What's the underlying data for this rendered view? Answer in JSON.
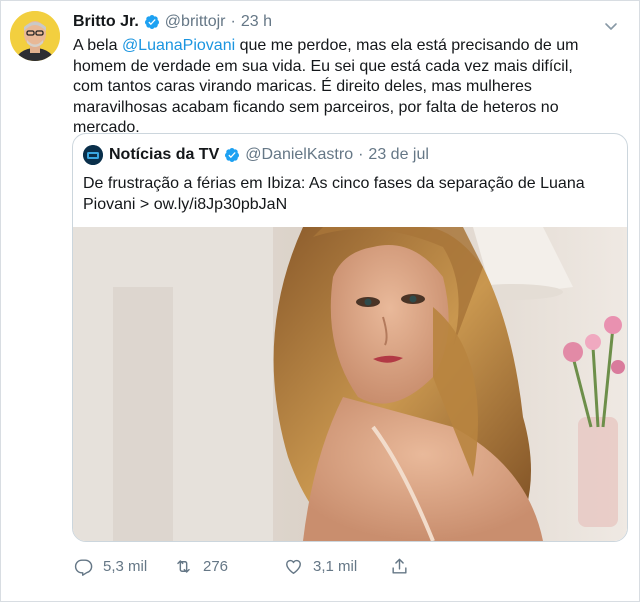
{
  "tweet": {
    "author_name": "Britto Jr.",
    "handle": "@brittojr",
    "separator": "·",
    "time": "23 h",
    "text_part1": "A bela ",
    "mention": "@LuanaPiovani",
    "text_part2": " que me perdoe, mas ela está precisando de um homem de verdade em sua vida. Eu sei que está cada vez mais difícil, com tantos caras virando maricas. É direito deles, mas mulheres maravilhosas acabam ficando sem parceiros, por falta de heteros no mercado."
  },
  "quoted": {
    "author_name": "Notícias da TV",
    "handle": "@DanielKastro",
    "separator": "·",
    "date": "23 de jul",
    "text": "De frustração a férias em Ibiza: As cinco fases da separação de Luana Piovani > ow.ly/i8Jp30pbJaN"
  },
  "actions": {
    "replies": "5,3 mil",
    "retweets": "276",
    "likes": "3,1 mil"
  },
  "colors": {
    "link": "#1b95e0",
    "verified": "#1da1f2",
    "muted": "#657786"
  },
  "icons": [
    "verified-badge-icon",
    "chevron-down-icon",
    "reply-icon",
    "retweet-icon",
    "like-icon",
    "share-icon"
  ]
}
